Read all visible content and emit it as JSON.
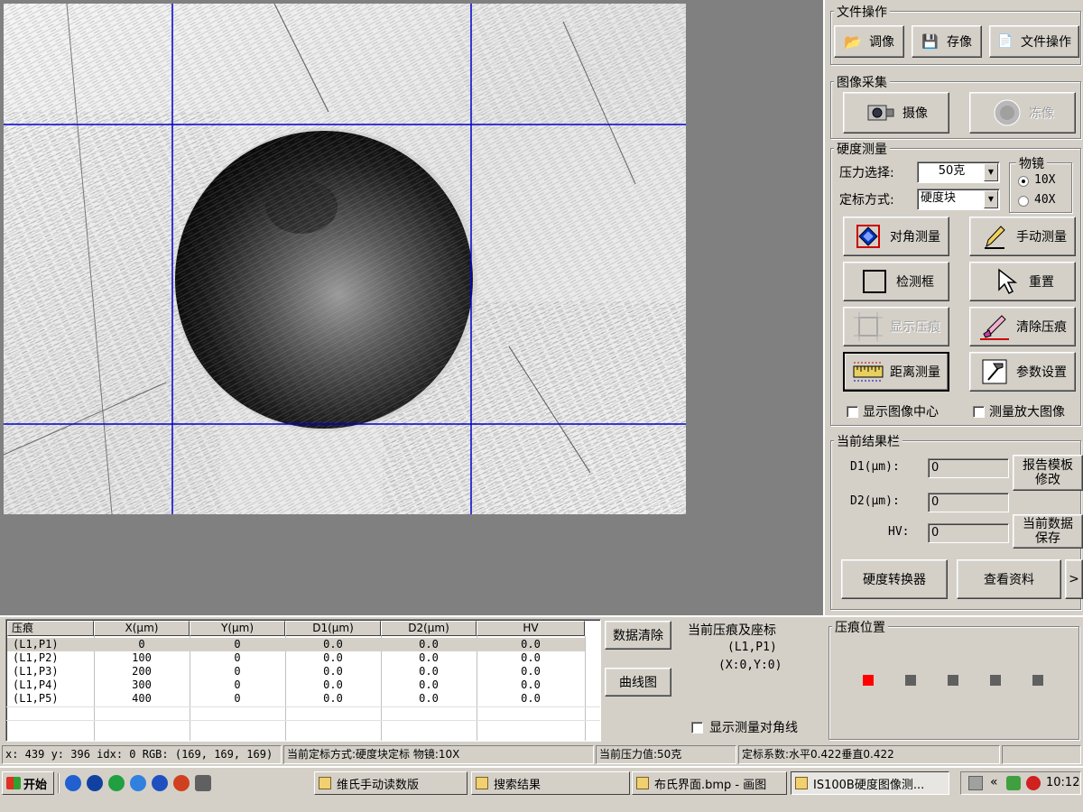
{
  "right_panel": {
    "file_ops": {
      "title": "文件操作",
      "load_label": "调像",
      "save_label": "存像",
      "doc_label": "文件操作"
    },
    "capture": {
      "title": "图像采集",
      "camera_label": "摄像",
      "freeze_label": "冻像"
    },
    "hardness": {
      "title": "硬度测量",
      "force_label": "压力选择:",
      "force_value": "50克",
      "calib_label": "定标方式:",
      "calib_value": "硬度块",
      "objective_title": "物镜",
      "obj_10x": "10X",
      "obj_40x": "40X",
      "diag_measure": "对角测量",
      "manual_measure": "手动测量",
      "detect_box": "检测框",
      "reset": "重置",
      "show_indent": "显示压痕",
      "clear_indent": "清除压痕",
      "distance_measure": "距离测量",
      "param_settings": "参数设置",
      "show_center": "显示图像中心",
      "zoom_image": "测量放大图像"
    },
    "result": {
      "title": "当前结果栏",
      "d1_label": "D1(μm):",
      "d1_value": "0",
      "d2_label": "D2(μm):",
      "d2_value": "0",
      "hv_label": "HV:",
      "hv_value": "0",
      "report_btn_line1": "报告模板",
      "report_btn_line2": "修改",
      "save_btn_line1": "当前数据",
      "save_btn_line2": "保存",
      "converter_btn": "硬度转换器",
      "view_btn": "查看资料",
      "more_btn": ">"
    }
  },
  "table": {
    "headers": [
      "压痕",
      "X(μm)",
      "Y(μm)",
      "D1(μm)",
      "D2(μm)",
      "HV"
    ],
    "rows": [
      [
        "(L1,P1)",
        "0",
        "0",
        "0.0",
        "0.0",
        "0.0"
      ],
      [
        "(L1,P2)",
        "100",
        "0",
        "0.0",
        "0.0",
        "0.0"
      ],
      [
        "(L1,P3)",
        "200",
        "0",
        "0.0",
        "0.0",
        "0.0"
      ],
      [
        "(L1,P4)",
        "300",
        "0",
        "0.0",
        "0.0",
        "0.0"
      ],
      [
        "(L1,P5)",
        "400",
        "0",
        "0.0",
        "0.0",
        "0.0"
      ]
    ]
  },
  "bottom_controls": {
    "clear_data": "数据清除",
    "curve_chart": "曲线图",
    "current_title": "当前压痕及座标",
    "current_point": "(L1,P1)",
    "current_coord": "(X:0,Y:0)",
    "show_diag": "显示测量对角线",
    "position_title": "压痕位置",
    "positions": [
      {
        "color": "#ff0000",
        "active": true
      },
      {
        "color": "#606060",
        "active": false
      },
      {
        "color": "#606060",
        "active": false
      },
      {
        "color": "#606060",
        "active": false
      },
      {
        "color": "#606060",
        "active": false
      }
    ]
  },
  "status_bar": {
    "coords": "x: 439 y: 396  idx: 0  RGB: (169, 169, 169)",
    "calib": "当前定标方式:硬度块定标  物镜:10X",
    "force": "当前压力值:50克",
    "coef": "定标系数:水平0.422垂直0.422"
  },
  "taskbar": {
    "start": "开始",
    "tasks": [
      {
        "label": "维氏手动读数版",
        "active": false
      },
      {
        "label": "搜索结果",
        "active": false
      },
      {
        "label": "布氏界面.bmp - 画图",
        "active": false
      },
      {
        "label": "IS100B硬度图像测...",
        "active": true
      }
    ],
    "chevron": "«",
    "clock": "10:12"
  },
  "colors": {
    "grid_line": "#0000cc",
    "active_marker": "#ff0000",
    "inactive_marker": "#606060"
  }
}
